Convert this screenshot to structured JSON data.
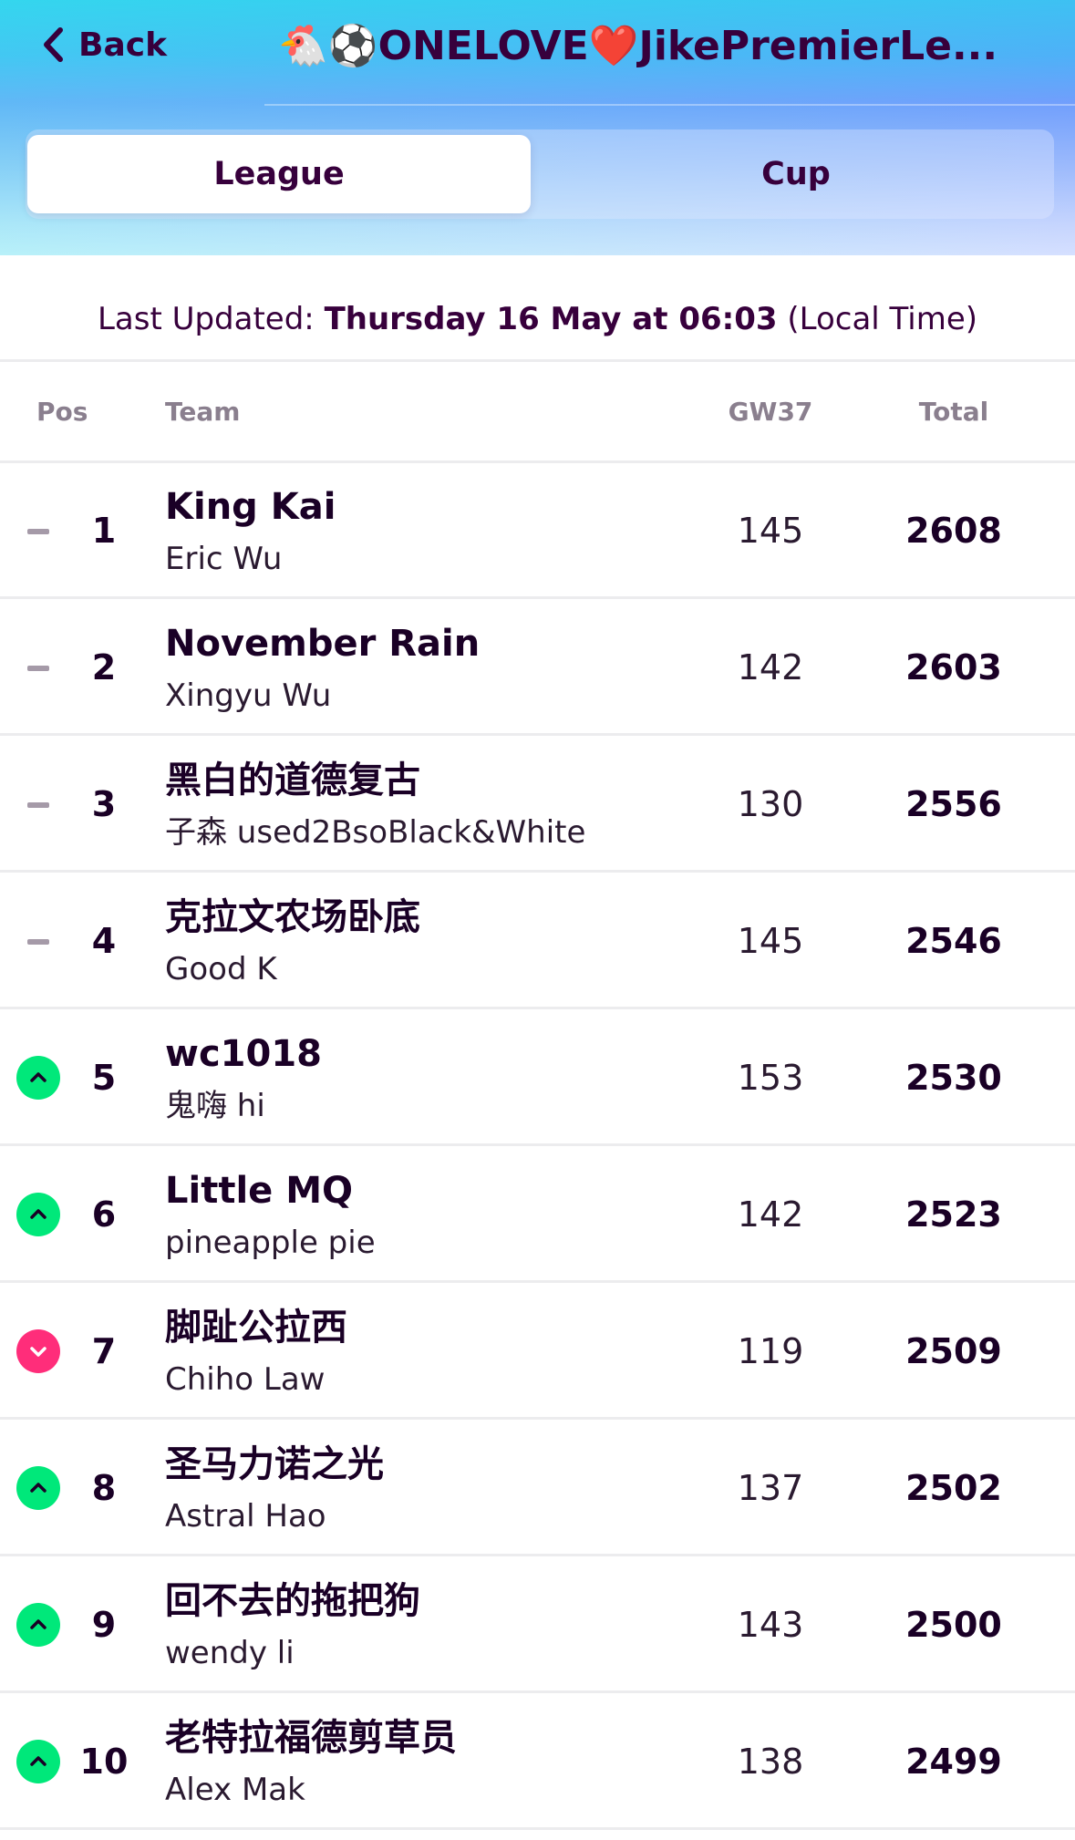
{
  "nav": {
    "back_label": "Back",
    "title": "🐔⚽ONELOVE❤️JikePremierLe..."
  },
  "tabs": [
    {
      "label": "League",
      "active": true
    },
    {
      "label": "Cup",
      "active": false
    }
  ],
  "updated": {
    "prefix": "Last Updated: ",
    "datetime": "Thursday 16 May at 06:03",
    "suffix": " (Local Time)"
  },
  "table": {
    "headers": {
      "pos": "Pos",
      "team": "Team",
      "gw": "GW37",
      "total": "Total"
    },
    "rows": [
      {
        "movement": "same",
        "pos": "1",
        "team": "King Kai",
        "manager": "Eric Wu",
        "gw": "145",
        "total": "2608"
      },
      {
        "movement": "same",
        "pos": "2",
        "team": "November Rain",
        "manager": "Xingyu Wu",
        "gw": "142",
        "total": "2603"
      },
      {
        "movement": "same",
        "pos": "3",
        "team": "黑白的道德复古",
        "manager": "子森 used2BsoBlack&White",
        "gw": "130",
        "total": "2556"
      },
      {
        "movement": "same",
        "pos": "4",
        "team": "克拉文农场卧底",
        "manager": "Good K",
        "gw": "145",
        "total": "2546"
      },
      {
        "movement": "up",
        "pos": "5",
        "team": "wc1018",
        "manager": "鬼嗨 hi",
        "gw": "153",
        "total": "2530"
      },
      {
        "movement": "up",
        "pos": "6",
        "team": "Little MQ",
        "manager": "pineapple pie",
        "gw": "142",
        "total": "2523"
      },
      {
        "movement": "down",
        "pos": "7",
        "team": "脚趾公拉西",
        "manager": "Chiho Law",
        "gw": "119",
        "total": "2509"
      },
      {
        "movement": "up",
        "pos": "8",
        "team": "圣马力诺之光",
        "manager": "Astral Hao",
        "gw": "137",
        "total": "2502"
      },
      {
        "movement": "up",
        "pos": "9",
        "team": "回不去的拖把狗",
        "manager": "wendy li",
        "gw": "143",
        "total": "2500"
      },
      {
        "movement": "up",
        "pos": "10",
        "team": "老特拉福德剪草员",
        "manager": "Alex Mak",
        "gw": "138",
        "total": "2499"
      }
    ]
  },
  "colors": {
    "primary_text": "#37003c",
    "up": "#00e87a",
    "down": "#ff2d7a",
    "same": "#a59aa8"
  }
}
